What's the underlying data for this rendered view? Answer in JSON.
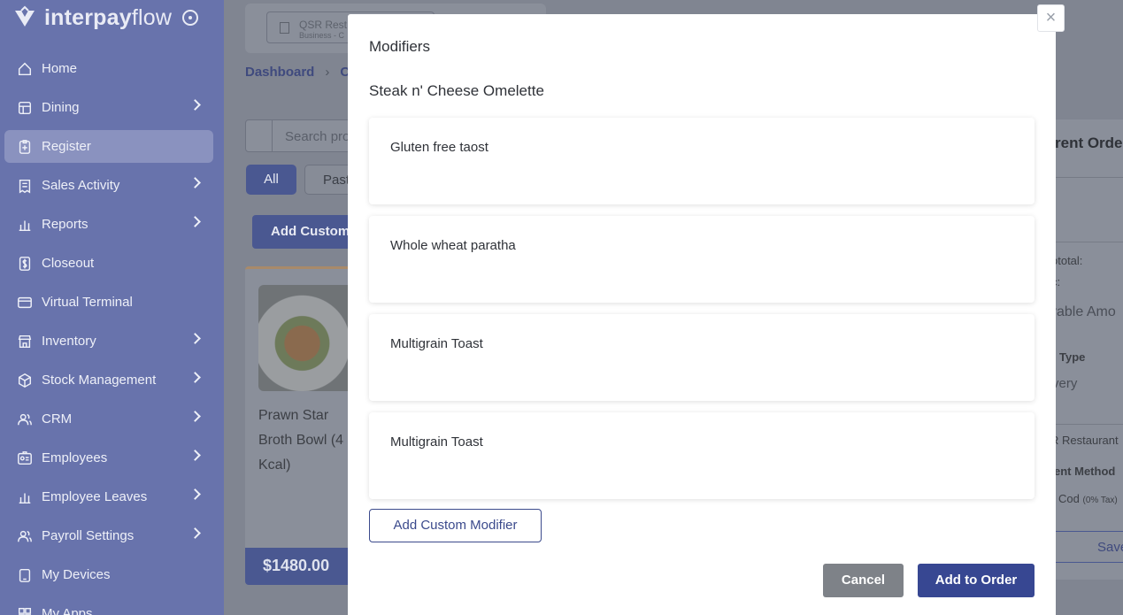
{
  "brand": {
    "name_bold": "interpay",
    "name_light": "flow"
  },
  "sidebar": {
    "items": [
      {
        "label": "Home",
        "icon": "home-icon",
        "has_chevron": false
      },
      {
        "label": "Dining",
        "icon": "table-icon",
        "has_chevron": true
      },
      {
        "label": "Register",
        "icon": "clipboard-icon",
        "has_chevron": false,
        "active": true
      },
      {
        "label": "Sales Activity",
        "icon": "receipt-icon",
        "has_chevron": true
      },
      {
        "label": "Reports",
        "icon": "bar-chart-icon",
        "has_chevron": true
      },
      {
        "label": "Closeout",
        "icon": "dollar-icon",
        "has_chevron": false
      },
      {
        "label": "Virtual Terminal",
        "icon": "credit-card-icon",
        "has_chevron": false
      },
      {
        "label": "Inventory",
        "icon": "store-icon",
        "has_chevron": true
      },
      {
        "label": "Stock Management",
        "icon": "box-icon",
        "has_chevron": true
      },
      {
        "label": "CRM",
        "icon": "users-icon",
        "has_chevron": true
      },
      {
        "label": "Employees",
        "icon": "id-card-icon",
        "has_chevron": true
      },
      {
        "label": "Employee Leaves",
        "icon": "bar-chart-icon",
        "has_chevron": true
      },
      {
        "label": "Payroll Settings",
        "icon": "users-icon",
        "has_chevron": true
      },
      {
        "label": "My Devices",
        "icon": "device-icon",
        "has_chevron": false
      },
      {
        "label": "My Apps",
        "icon": "apps-icon",
        "has_chevron": false
      }
    ]
  },
  "background": {
    "business_name": "QSR Rest",
    "business_sub": "Business - C",
    "breadcrumb": [
      "Dashboard",
      "C"
    ],
    "search_placeholder": "Search pro",
    "filter_all": "All",
    "filter_past": "Past",
    "add_custom": "Add Custom",
    "product": {
      "name": "Prawn Star Broth Bowl (4 Kcal)",
      "price": "$1480.00"
    },
    "order": {
      "title": "rent Orde",
      "subtotal": "ototal:",
      "tax": "c:",
      "payable": "yable Amo",
      "order_type_label": "Type",
      "order_type_value": "very",
      "location": "R Restaurant",
      "payment_label": "ent Method",
      "payment_value": "Cod",
      "payment_tax": "(0% Tax)",
      "save": "Save"
    }
  },
  "modal": {
    "title": "Modifiers",
    "item_name": "Steak n' Cheese Omelette",
    "modifiers": [
      {
        "label": "Gluten free taost"
      },
      {
        "label": "Whole wheat paratha"
      },
      {
        "label": "Multigrain Toast"
      },
      {
        "label": "Multigrain Toast"
      }
    ],
    "add_custom_label": "Add Custom Modifier",
    "cancel_label": "Cancel",
    "add_to_order_label": "Add to Order",
    "close_glyph": "×"
  }
}
